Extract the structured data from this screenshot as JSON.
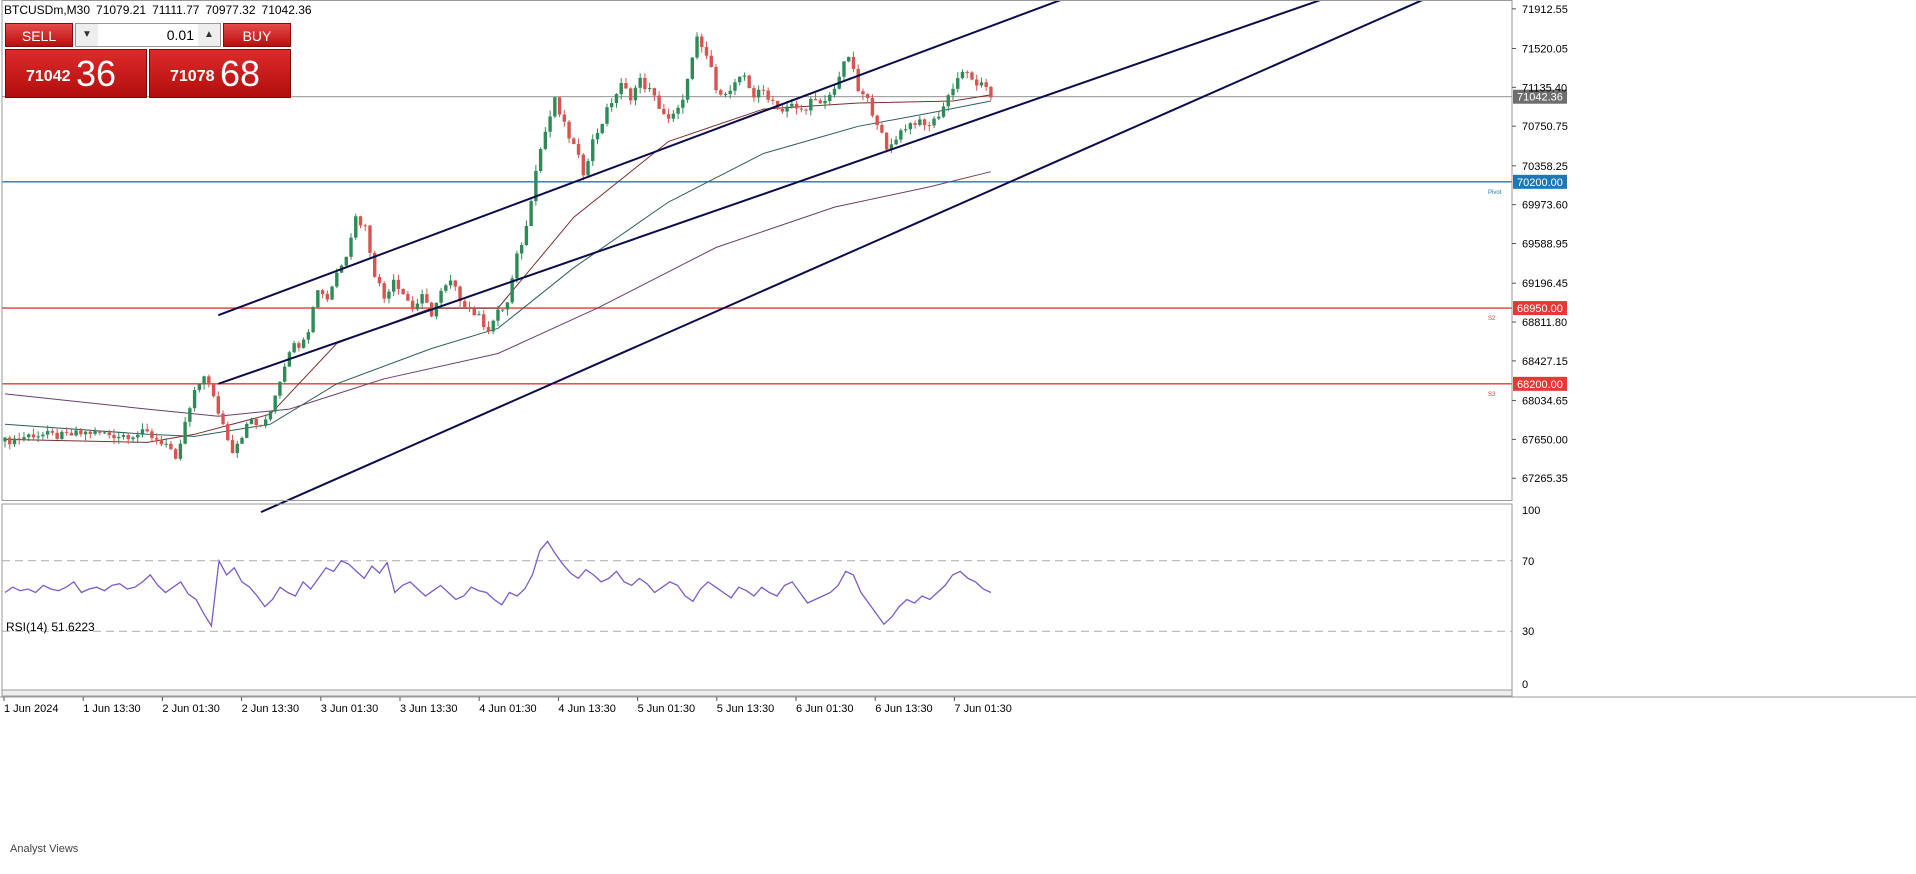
{
  "header": {
    "symbol": "BTCUSDm,M30",
    "open": "71079.21",
    "high": "71111.77",
    "low": "70977.32",
    "close": "71042.36"
  },
  "trade_panel": {
    "sell_label": "SELL",
    "buy_label": "BUY",
    "lot_value": "0.01",
    "lot_down_icon": "caret-down-icon",
    "lot_up_icon": "caret-up-icon",
    "sell_main": "71042",
    "sell_big": "36",
    "buy_main": "71078",
    "buy_big": "68"
  },
  "rsi_panel": {
    "label": "RSI(14)",
    "value": "51.6223"
  },
  "analyst_label": "Analyst Views",
  "colors": {
    "bull": "#2e8b57",
    "bear": "#d9534f",
    "channel": "#0c0c4a",
    "pivot": "#1f77b4",
    "support": "#e53935",
    "rsi": "#7b5cc6",
    "ma_fast": "#7a2e2e",
    "ma_mid": "#2f5f5f",
    "ma_slow": "#6b3f6b"
  },
  "chart_data": [
    {
      "type": "candlestick",
      "title": "",
      "ylim": [
        67050,
        72000
      ],
      "y_ticks": [
        "71912.55",
        "71520.05",
        "71135.40",
        "70750.75",
        "70358.25",
        "69973.60",
        "69588.95",
        "69196.45",
        "68811.80",
        "68427.15",
        "68034.65",
        "67650.00",
        "67265.35"
      ],
      "x_ticks": [
        "1 Jun 2024",
        "1 Jun 13:30",
        "2 Jun 01:30",
        "2 Jun 13:30",
        "3 Jun 01:30",
        "3 Jun 13:30",
        "4 Jun 01:30",
        "4 Jun 13:30",
        "5 Jun 01:30",
        "5 Jun 13:30",
        "6 Jun 01:30",
        "6 Jun 13:30",
        "7 Jun 01:30"
      ],
      "levels": [
        {
          "price": 71042.36,
          "label": "71042.36",
          "color": "#6e6e6e",
          "tag": ""
        },
        {
          "price": 70200.0,
          "label": "70200.00",
          "color": "#1f77b4",
          "tag": "Pivot"
        },
        {
          "price": 68950.0,
          "label": "68950.00",
          "color": "#e53935",
          "tag": "S2"
        },
        {
          "price": 68200.0,
          "label": "68200.00",
          "color": "#e53935",
          "tag": "S3"
        }
      ],
      "channel_lines": [
        {
          "from": [
            "1 Jun 22:00",
            68880
          ],
          "to": [
            "5 Jun 16:00",
            72040
          ]
        },
        {
          "from": [
            "1 Jun 22:00",
            68200
          ],
          "to": [
            "6 Jun 19:30",
            72040
          ]
        },
        {
          "from": [
            "2 Jun 02:30",
            66930
          ],
          "to": [
            "7 Jun 06:00",
            72040
          ]
        }
      ],
      "close_path": [
        [
          0,
          67630
        ],
        [
          6,
          67700
        ],
        [
          12,
          67680
        ],
        [
          18,
          67720
        ],
        [
          24,
          67690
        ],
        [
          30,
          67710
        ],
        [
          34,
          67600
        ],
        [
          36,
          67420
        ],
        [
          38,
          67800
        ],
        [
          40,
          68100
        ],
        [
          42,
          68300
        ],
        [
          44,
          68050
        ],
        [
          46,
          67800
        ],
        [
          48,
          67550
        ],
        [
          50,
          67700
        ],
        [
          52,
          67850
        ],
        [
          54,
          67750
        ],
        [
          56,
          67950
        ],
        [
          58,
          68250
        ],
        [
          60,
          68550
        ],
        [
          62,
          68600
        ],
        [
          64,
          68750
        ],
        [
          66,
          69150
        ],
        [
          68,
          69050
        ],
        [
          70,
          69300
        ],
        [
          72,
          69500
        ],
        [
          74,
          69850
        ],
        [
          76,
          69750
        ],
        [
          78,
          69300
        ],
        [
          80,
          69050
        ],
        [
          82,
          69250
        ],
        [
          84,
          69100
        ],
        [
          86,
          68950
        ],
        [
          88,
          69050
        ],
        [
          90,
          68900
        ],
        [
          92,
          69100
        ],
        [
          94,
          69200
        ],
        [
          96,
          69050
        ],
        [
          98,
          68950
        ],
        [
          100,
          68850
        ],
        [
          102,
          68750
        ],
        [
          104,
          68900
        ],
        [
          106,
          69000
        ],
        [
          108,
          69450
        ],
        [
          110,
          69750
        ],
        [
          112,
          70350
        ],
        [
          114,
          70700
        ],
        [
          116,
          71000
        ],
        [
          118,
          70750
        ],
        [
          120,
          70550
        ],
        [
          122,
          70300
        ],
        [
          124,
          70600
        ],
        [
          126,
          70800
        ],
        [
          128,
          71000
        ],
        [
          130,
          71150
        ],
        [
          132,
          71050
        ],
        [
          134,
          71200
        ],
        [
          136,
          71100
        ],
        [
          138,
          70950
        ],
        [
          140,
          70800
        ],
        [
          142,
          70900
        ],
        [
          144,
          71200
        ],
        [
          146,
          71600
        ],
        [
          148,
          71450
        ],
        [
          150,
          71150
        ],
        [
          152,
          71050
        ],
        [
          154,
          71150
        ],
        [
          156,
          71250
        ],
        [
          158,
          71050
        ],
        [
          160,
          71100
        ],
        [
          162,
          71000
        ],
        [
          164,
          70900
        ],
        [
          166,
          70950
        ],
        [
          168,
          70900
        ],
        [
          170,
          71000
        ],
        [
          172,
          70950
        ],
        [
          174,
          71050
        ],
        [
          176,
          71250
        ],
        [
          178,
          71450
        ],
        [
          180,
          71100
        ],
        [
          182,
          71000
        ],
        [
          184,
          70800
        ],
        [
          186,
          70500
        ],
        [
          188,
          70650
        ],
        [
          190,
          70750
        ],
        [
          192,
          70800
        ],
        [
          194,
          70750
        ],
        [
          196,
          70800
        ],
        [
          198,
          70950
        ],
        [
          200,
          71150
        ],
        [
          202,
          71300
        ],
        [
          204,
          71200
        ],
        [
          206,
          71150
        ],
        [
          208,
          71042
        ]
      ],
      "moving_averages": [
        {
          "name": "",
          "color": "#7a2e2e",
          "points": [
            [
              0,
              67650
            ],
            [
              30,
              67620
            ],
            [
              40,
              67700
            ],
            [
              56,
              67900
            ],
            [
              70,
              68600
            ],
            [
              90,
              68950
            ],
            [
              104,
              68950
            ],
            [
              120,
              69850
            ],
            [
              140,
              70600
            ],
            [
              160,
              70920
            ],
            [
              180,
              70980
            ],
            [
              200,
              71000
            ],
            [
              208,
              71060
            ]
          ]
        },
        {
          "name": "",
          "color": "#2f5f5f",
          "points": [
            [
              0,
              67800
            ],
            [
              30,
              67700
            ],
            [
              40,
              67680
            ],
            [
              56,
              67800
            ],
            [
              70,
              68200
            ],
            [
              90,
              68550
            ],
            [
              104,
              68750
            ],
            [
              120,
              69350
            ],
            [
              140,
              70000
            ],
            [
              160,
              70480
            ],
            [
              180,
              70750
            ],
            [
              195,
              70880
            ],
            [
              208,
              71000
            ]
          ]
        },
        {
          "name": "",
          "color": "#6b3f6b",
          "points": [
            [
              0,
              68100
            ],
            [
              30,
              67950
            ],
            [
              45,
              67880
            ],
            [
              60,
              67950
            ],
            [
              80,
              68250
            ],
            [
              104,
              68500
            ],
            [
              125,
              68950
            ],
            [
              150,
              69550
            ],
            [
              175,
              69950
            ],
            [
              195,
              70150
            ],
            [
              208,
              70300
            ]
          ]
        }
      ]
    },
    {
      "type": "line",
      "title": "RSI(14) 51.6223",
      "ylim": [
        0,
        100
      ],
      "y_ticks": [
        "100",
        "70",
        "30",
        "0"
      ],
      "reference_lines": [
        70,
        30
      ],
      "series": [
        {
          "name": "",
          "color": "#7b5cc6",
          "values": [
            52,
            55,
            53,
            54,
            52,
            56,
            54,
            53,
            55,
            58,
            52,
            54,
            55,
            53,
            56,
            57,
            54,
            55,
            58,
            62,
            56,
            52,
            55,
            58,
            51,
            48,
            40,
            33,
            70,
            62,
            66,
            58,
            55,
            50,
            44,
            48,
            55,
            52,
            50,
            58,
            54,
            60,
            66,
            64,
            70,
            68,
            64,
            60,
            67,
            63,
            69,
            52,
            56,
            58,
            54,
            50,
            53,
            56,
            52,
            48,
            50,
            55,
            53,
            52,
            48,
            45,
            52,
            50,
            54,
            62,
            76,
            81,
            74,
            68,
            63,
            60,
            65,
            62,
            58,
            60,
            64,
            58,
            56,
            60,
            57,
            52,
            55,
            58,
            56,
            50,
            47,
            54,
            58,
            55,
            52,
            49,
            55,
            53,
            50,
            55,
            52,
            50,
            56,
            58,
            52,
            46,
            48,
            50,
            52,
            56,
            64,
            62,
            52,
            46,
            40,
            34,
            38,
            44,
            48,
            46,
            50,
            48,
            52,
            56,
            62,
            64,
            60,
            58,
            54,
            52
          ]
        }
      ]
    }
  ]
}
